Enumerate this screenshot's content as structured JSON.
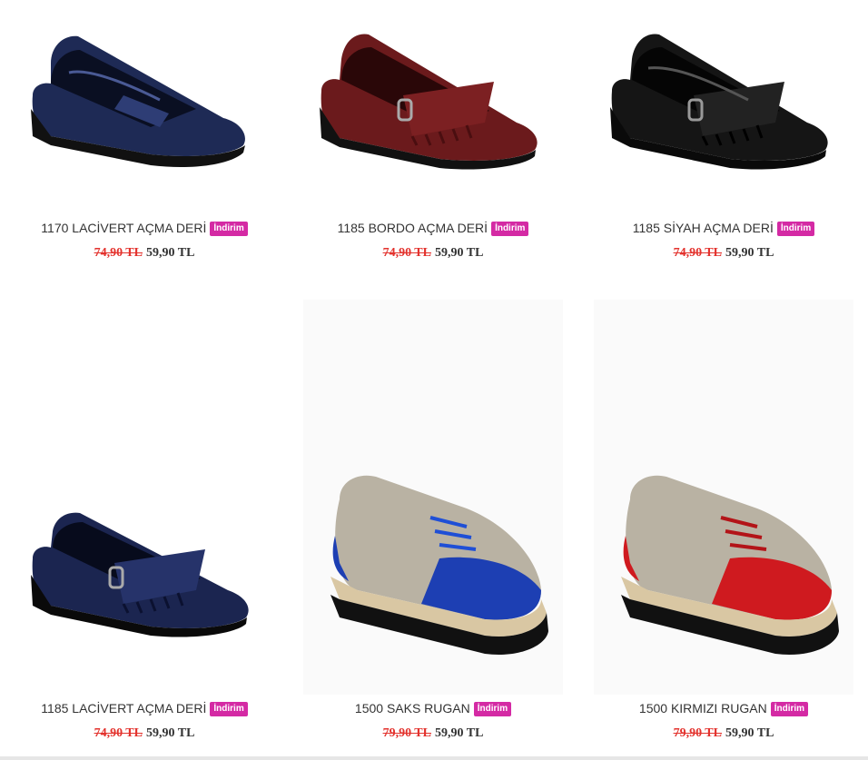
{
  "products": [
    {
      "title": "1170 LACİVERT AÇMA DERİ",
      "badge": "İndirim",
      "old_price": "74,90 TL",
      "new_price": "59,90 TL",
      "color": "#1e2a55",
      "style": "loafer"
    },
    {
      "title": "1185 BORDO AÇMA DERİ",
      "badge": "İndirim",
      "old_price": "74,90 TL",
      "new_price": "59,90 TL",
      "color": "#6b1a1c",
      "style": "fringe"
    },
    {
      "title": "1185 SİYAH AÇMA DERİ",
      "badge": "İndirim",
      "old_price": "74,90 TL",
      "new_price": "59,90 TL",
      "color": "#151515",
      "style": "fringe"
    },
    {
      "title": "1185 LACİVERT AÇMA DERİ",
      "badge": "İndirim",
      "old_price": "74,90 TL",
      "new_price": "59,90 TL",
      "color": "#1b2550",
      "style": "fringe"
    },
    {
      "title": "1500 SAKS RUGAN",
      "badge": "İndirim",
      "old_price": "79,90 TL",
      "new_price": "59,90 TL",
      "color": "#1d3fb3",
      "style": "oxford"
    },
    {
      "title": "1500 KIRMIZI RUGAN",
      "badge": "İndirim",
      "old_price": "79,90 TL",
      "new_price": "59,90 TL",
      "color": "#cf1a1f",
      "style": "oxford"
    }
  ]
}
